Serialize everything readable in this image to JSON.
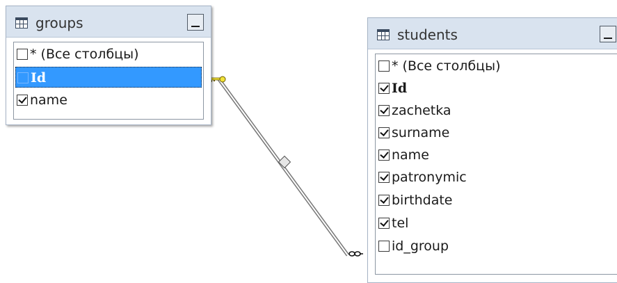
{
  "tables": {
    "groups": {
      "title": "groups",
      "icon": "table-icon",
      "rows": [
        {
          "label": "* (Все столбцы)",
          "checked": false,
          "key": false
        },
        {
          "label": "Id",
          "checked": false,
          "key": true
        },
        {
          "label": "name",
          "checked": true,
          "key": false
        }
      ]
    },
    "students": {
      "title": "students",
      "icon": "table-icon",
      "rows": [
        {
          "label": "* (Все столбцы)",
          "checked": false,
          "key": false
        },
        {
          "label": "Id",
          "checked": true,
          "key": true
        },
        {
          "label": "zachetka",
          "checked": true,
          "key": false
        },
        {
          "label": "surname",
          "checked": true,
          "key": false
        },
        {
          "label": "name",
          "checked": true,
          "key": false
        },
        {
          "label": "patronymic",
          "checked": true,
          "key": false
        },
        {
          "label": "birthdate",
          "checked": true,
          "key": false
        },
        {
          "label": "tel",
          "checked": true,
          "key": false
        },
        {
          "label": "id_group",
          "checked": false,
          "key": false
        }
      ]
    }
  },
  "relationship": {
    "from_icon": "key-icon",
    "to_icon": "infinity-icon",
    "selection_color": "#3399ff"
  }
}
